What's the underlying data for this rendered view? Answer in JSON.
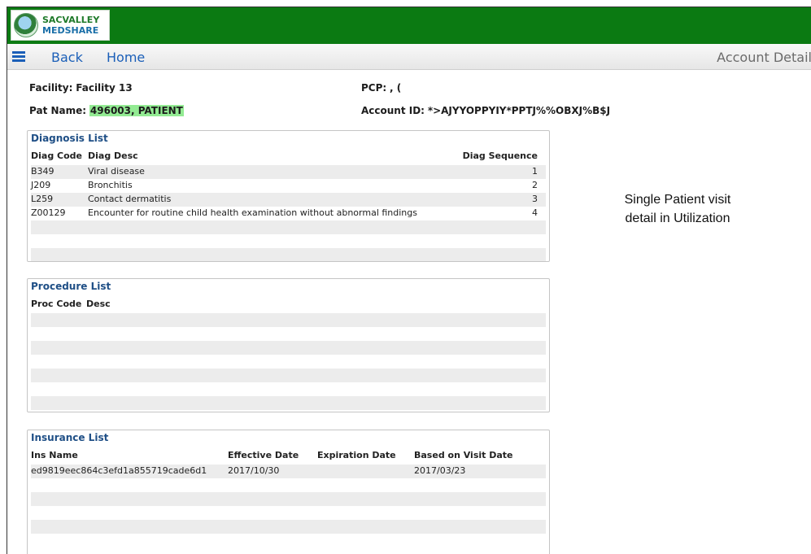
{
  "brand": {
    "line1": "SACVALLEY",
    "line2": "MEDSHARE"
  },
  "nav": {
    "back_label": "Back",
    "home_label": "Home",
    "page_title": "Account Detail",
    "menu_icon": "hamburger-menu-icon"
  },
  "header": {
    "facility_label": "Facility:",
    "facility_value": "Facility 13",
    "pcp_label": "PCP:",
    "pcp_value": ", (",
    "patname_label": "Pat Name:",
    "patname_value": "496003, PATIENT",
    "account_label": "Account ID:",
    "account_value": "*>AJYYOPPYIY*PPTJ%%OBXJ%B$J"
  },
  "annotation": {
    "line1": "Single Patient visit",
    "line2": "detail in Utilization"
  },
  "diagnosis": {
    "title": "Diagnosis List",
    "columns": {
      "code": "Diag Code",
      "desc": "Diag Desc",
      "sequence": "Diag Sequence"
    },
    "rows": [
      {
        "code": "B349",
        "desc": "Viral disease",
        "sequence": "1"
      },
      {
        "code": "J209",
        "desc": "Bronchitis",
        "sequence": "2"
      },
      {
        "code": "L259",
        "desc": "Contact dermatitis",
        "sequence": "3"
      },
      {
        "code": "Z00129",
        "desc": "Encounter for routine child health examination without abnormal findings",
        "sequence": "4"
      }
    ]
  },
  "procedure": {
    "title": "Procedure List",
    "columns": {
      "code": "Proc Code",
      "desc": "Desc"
    },
    "rows": []
  },
  "insurance": {
    "title": "Insurance List",
    "columns": {
      "name": "Ins Name",
      "effective": "Effective Date",
      "expiration": "Expiration Date",
      "visit": "Based on Visit Date"
    },
    "rows": [
      {
        "name": "ed9819eec864c3efd1a855719cade6d1",
        "effective": "2017/10/30",
        "expiration": "",
        "visit": "2017/03/23"
      }
    ]
  }
}
